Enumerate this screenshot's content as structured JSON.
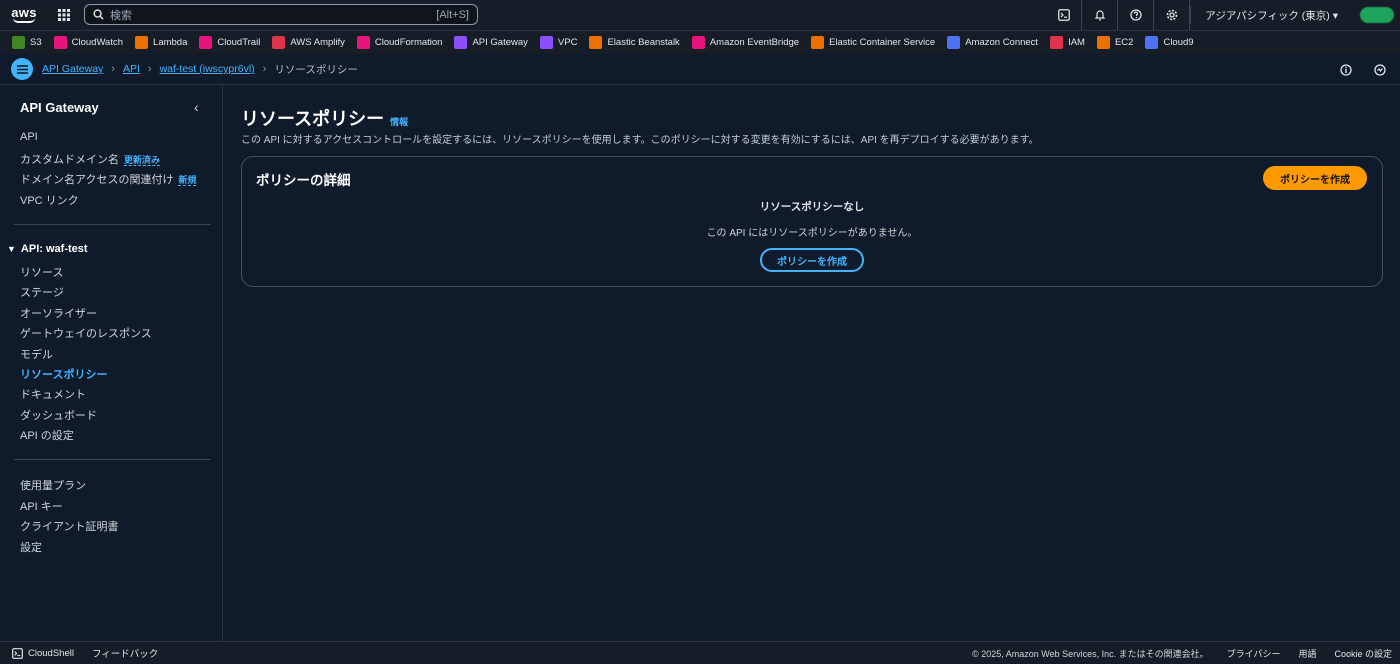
{
  "topnav": {
    "logo_text": "aws",
    "search_placeholder": "検索",
    "search_shortcut": "[Alt+S]",
    "region": "アジアパシフィック (東京) ▾"
  },
  "favorites": [
    {
      "label": "S3",
      "color": "#3f8624"
    },
    {
      "label": "CloudWatch",
      "color": "#e7157b"
    },
    {
      "label": "Lambda",
      "color": "#ed7100"
    },
    {
      "label": "CloudTrail",
      "color": "#e7157b"
    },
    {
      "label": "AWS Amplify",
      "color": "#dd344c"
    },
    {
      "label": "CloudFormation",
      "color": "#e7157b"
    },
    {
      "label": "API Gateway",
      "color": "#8c4fff"
    },
    {
      "label": "VPC",
      "color": "#8c4fff"
    },
    {
      "label": "Elastic Beanstalk",
      "color": "#ed7100"
    },
    {
      "label": "Amazon EventBridge",
      "color": "#e7157b"
    },
    {
      "label": "Elastic Container Service",
      "color": "#ed7100"
    },
    {
      "label": "Amazon Connect",
      "color": "#4d72f3"
    },
    {
      "label": "IAM",
      "color": "#dd344c"
    },
    {
      "label": "EC2",
      "color": "#ed7100"
    },
    {
      "label": "Cloud9",
      "color": "#4d72f3"
    }
  ],
  "breadcrumb": {
    "items": [
      "API Gateway",
      "API",
      "waf-test (iwscypr6vl)"
    ],
    "current": "リソースポリシー"
  },
  "sidebar": {
    "title": "API Gateway",
    "top_items": [
      {
        "label": "API",
        "badge": ""
      },
      {
        "label": "カスタムドメイン名",
        "badge": "更新済み"
      },
      {
        "label": "ドメイン名アクセスの関連付け",
        "badge": "新規"
      },
      {
        "label": "VPC リンク",
        "badge": ""
      }
    ],
    "api_section": "API: waf-test",
    "api_items": [
      "リソース",
      "ステージ",
      "オーソライザー",
      "ゲートウェイのレスポンス",
      "モデル",
      "リソースポリシー",
      "ドキュメント",
      "ダッシュボード",
      "API の設定"
    ],
    "bottom_items": [
      "使用量プラン",
      "API キー",
      "クライアント証明書",
      "設定"
    ]
  },
  "main": {
    "title": "リソースポリシー",
    "info": "情報",
    "description": "この API に対するアクセスコントロールを設定するには、リソースポリシーを使用します。このポリシーに対する変更を有効にするには、API を再デプロイする必要があります。",
    "panel_title": "ポリシーの詳細",
    "create_button": "ポリシーを作成",
    "empty_title": "リソースポリシーなし",
    "empty_desc": "この API にはリソースポリシーがありません。",
    "empty_button": "ポリシーを作成"
  },
  "footer": {
    "cloudshell": "CloudShell",
    "feedback": "フィードバック",
    "copyright": "© 2025, Amazon Web Services, Inc. またはその関連会社。",
    "privacy": "プライバシー",
    "terms": "用語",
    "cookie": "Cookie の設定"
  },
  "colors": {
    "accent": "#42b4ff",
    "primary_button": "#ff9900",
    "background": "#0f1b2a"
  }
}
